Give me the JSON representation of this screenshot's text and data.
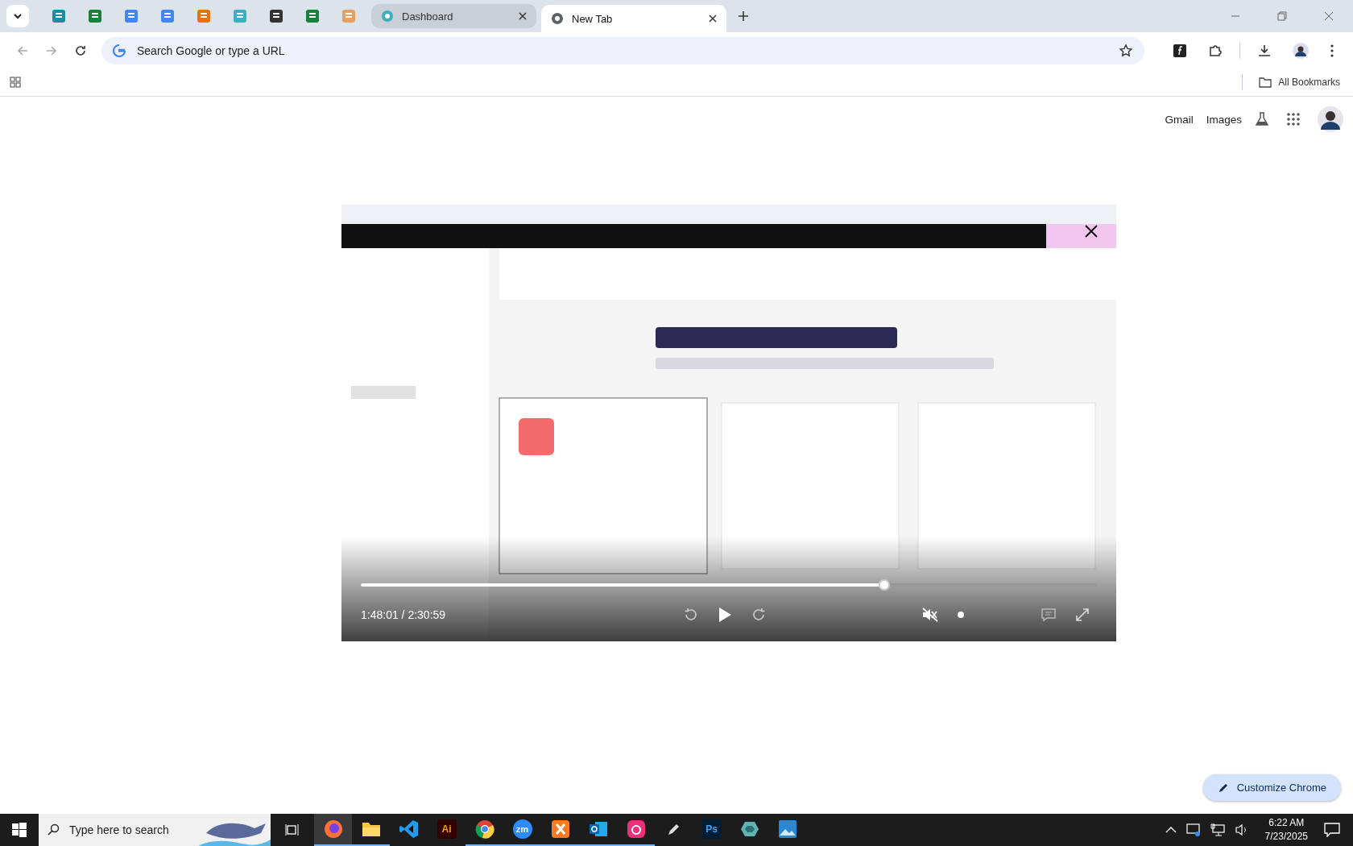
{
  "tabs": [
    {
      "title": "Dashboard",
      "selected": false
    },
    {
      "title": "New Tab",
      "selected": true
    }
  ],
  "address_bar": {
    "placeholder": "Search Google or type a URL"
  },
  "bookmarks_bar": {
    "folder": "All Bookmarks"
  },
  "header_links": [
    "Gmail",
    "Images"
  ],
  "video_player": {
    "time": "1:48:01 / 2:30:59",
    "level": 0.71,
    "muted": true
  },
  "customize_button": "Customize Chrome",
  "taskbar": {
    "search_placeholder": "Type here to search",
    "apps": [
      {
        "kind": "firefox",
        "running": true,
        "selected": true
      },
      {
        "kind": "folder",
        "running": true,
        "selected": false
      },
      {
        "kind": "code",
        "running": false,
        "selected": false
      },
      {
        "kind": "illustrator",
        "label": "Ai",
        "running": false,
        "selected": false
      },
      {
        "kind": "chrome",
        "running": true,
        "selected": false
      },
      {
        "kind": "zoom",
        "label": "zm",
        "running": true,
        "selected": false
      },
      {
        "kind": "xampp",
        "running": true,
        "selected": false
      },
      {
        "kind": "outlook",
        "running": true,
        "selected": false
      },
      {
        "kind": "cloud",
        "running": true,
        "selected": false
      },
      {
        "kind": "pen",
        "running": false,
        "selected": false
      },
      {
        "kind": "photoshop",
        "label": "Ps",
        "running": false,
        "selected": false
      },
      {
        "kind": "gem",
        "running": false,
        "selected": false
      },
      {
        "kind": "photos",
        "running": false,
        "selected": false
      }
    ],
    "time": "6:22 AM",
    "date": "7/23/2025"
  }
}
